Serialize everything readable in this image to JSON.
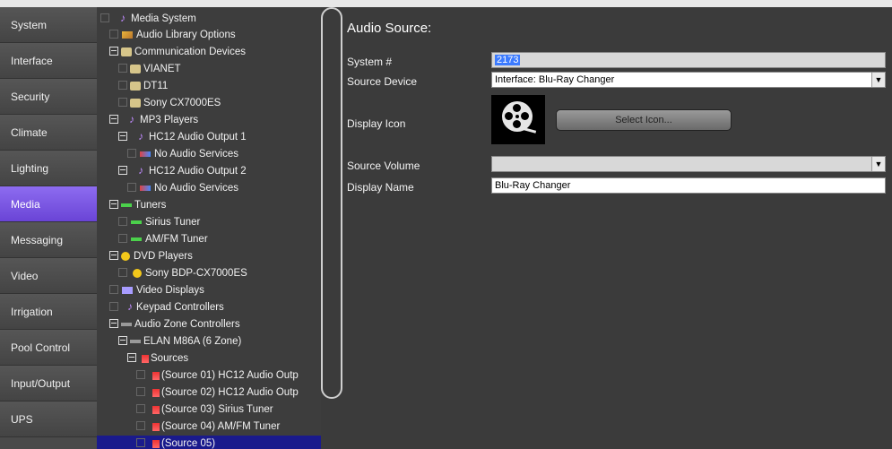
{
  "nav": {
    "items": [
      {
        "label": "System",
        "active": false
      },
      {
        "label": "Interface",
        "active": false
      },
      {
        "label": "Security",
        "active": false
      },
      {
        "label": "Climate",
        "active": false
      },
      {
        "label": "Lighting",
        "active": false
      },
      {
        "label": "Media",
        "active": true
      },
      {
        "label": "Messaging",
        "active": false
      },
      {
        "label": "Video",
        "active": false
      },
      {
        "label": "Irrigation",
        "active": false
      },
      {
        "label": "Pool Control",
        "active": false
      },
      {
        "label": "Input/Output",
        "active": false
      },
      {
        "label": "UPS",
        "active": false
      }
    ]
  },
  "tree": {
    "nodes": [
      {
        "label": "Media System",
        "icon": "music-note-icon"
      },
      {
        "label": "Audio Library Options",
        "icon": "library-icon"
      },
      {
        "label": "Communication Devices",
        "icon": "communication-device-icon"
      },
      {
        "label": "VIANET",
        "icon": "communication-device-icon"
      },
      {
        "label": "DT11",
        "icon": "communication-device-icon"
      },
      {
        "label": "Sony CX7000ES",
        "icon": "communication-device-icon"
      },
      {
        "label": "MP3 Players",
        "icon": "music-note-icon"
      },
      {
        "label": "HC12 Audio Output 1",
        "icon": "music-note-icon"
      },
      {
        "label": "No Audio Services",
        "icon": "audio-services-icon"
      },
      {
        "label": "HC12 Audio Output 2",
        "icon": "music-note-icon"
      },
      {
        "label": "No Audio Services",
        "icon": "audio-services-icon"
      },
      {
        "label": "Tuners",
        "icon": "tuner-icon"
      },
      {
        "label": "Sirius Tuner",
        "icon": "tuner-icon"
      },
      {
        "label": "AM/FM Tuner",
        "icon": "tuner-icon"
      },
      {
        "label": "DVD Players",
        "icon": "disc-icon"
      },
      {
        "label": "Sony BDP-CX7000ES",
        "icon": "disc-icon"
      },
      {
        "label": "Video Displays",
        "icon": "display-icon"
      },
      {
        "label": "Keypad Controllers",
        "icon": "music-note-icon"
      },
      {
        "label": "Audio Zone Controllers",
        "icon": "zone-controller-icon"
      },
      {
        "label": "ELAN M86A (6 Zone)",
        "icon": "zone-controller-icon"
      },
      {
        "label": "Sources",
        "icon": "source-icon"
      },
      {
        "label": "(Source 01) HC12 Audio Outp",
        "icon": "source-icon"
      },
      {
        "label": "(Source 02) HC12 Audio Outp",
        "icon": "source-icon"
      },
      {
        "label": "(Source 03) Sirius Tuner",
        "icon": "source-icon"
      },
      {
        "label": "(Source 04) AM/FM Tuner",
        "icon": "source-icon"
      },
      {
        "label": "(Source 05)",
        "icon": "source-icon"
      }
    ]
  },
  "form": {
    "title": "Audio Source:",
    "system_label": "System #",
    "system_value": "2173",
    "source_device_label": "Source Device",
    "source_device_value": "Interface: Blu-Ray Changer",
    "display_icon_label": "Display Icon",
    "select_icon_label": "Select Icon...",
    "source_volume_label": "Source Volume",
    "source_volume_value": "",
    "display_name_label": "Display Name",
    "display_name_value": "Blu-Ray Changer"
  },
  "colors": {
    "accent": "#7b56e6",
    "selection": "#1a1a8c",
    "background": "#3b3b3b"
  }
}
